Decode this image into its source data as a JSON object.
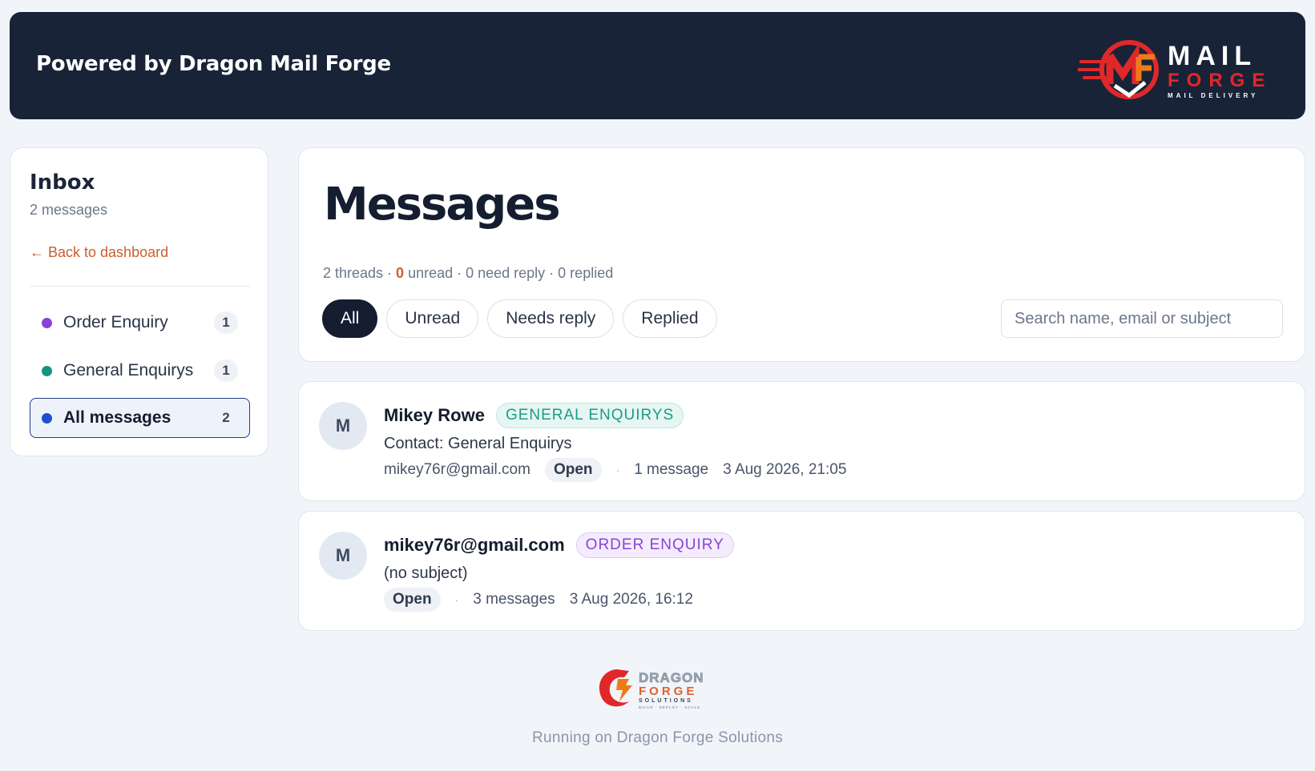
{
  "header": {
    "title": "Powered by Dragon Mail Forge",
    "logo": {
      "line1": "MAIL",
      "line2": "FORGE",
      "tagline": "MAIL DELIVERY",
      "icon": "mail-forge-logo"
    }
  },
  "sidebar": {
    "title": "Inbox",
    "count": "2 messages",
    "back_link": "← Back to dashboard",
    "folders": [
      {
        "label": "Order Enquiry",
        "count": "1",
        "color": "#8b3fdb"
      },
      {
        "label": "General Enquirys",
        "count": "1",
        "color": "#14937f"
      },
      {
        "label": "All messages",
        "count": "2",
        "color": "#1f4fd1",
        "active": true
      }
    ]
  },
  "main": {
    "title": "Messages",
    "stats": {
      "threads": "2 threads · ",
      "unread_count": "0",
      "rest": " unread · 0 need reply · 0 replied"
    },
    "filters": [
      "All",
      "Unread",
      "Needs reply",
      "Replied"
    ],
    "active_filter": "All",
    "search_placeholder": "Search name, email or subject"
  },
  "threads": [
    {
      "avatar": "M",
      "name": "Mikey Rowe",
      "tag": "GENERAL ENQUIRYS",
      "subject": "Contact: General Enquirys",
      "email": "mikey76r@gmail.com",
      "status": "Open",
      "separator": "·",
      "count": "1 message",
      "date": "3 Aug 2026, 21:05"
    },
    {
      "avatar": "M",
      "name": "mikey76r@gmail.com",
      "tag": "ORDER ENQUIRY",
      "subject": "(no subject)",
      "status": "Open",
      "separator": "·",
      "count": "3 messages",
      "date": "3 Aug 2026, 16:12"
    }
  ],
  "footer": {
    "logo": {
      "line1": "DRAGON",
      "line2": "FORGE",
      "line3": "SOLUTIONS",
      "tagline": "BUILD · DEPLOY · SCALE"
    },
    "text": "Running on Dragon Forge Solutions"
  },
  "colors": {
    "header_bg": "#192338",
    "accent": "#c8602d",
    "brand_red": "#e0282b",
    "brand_orange": "#f07a1a"
  }
}
